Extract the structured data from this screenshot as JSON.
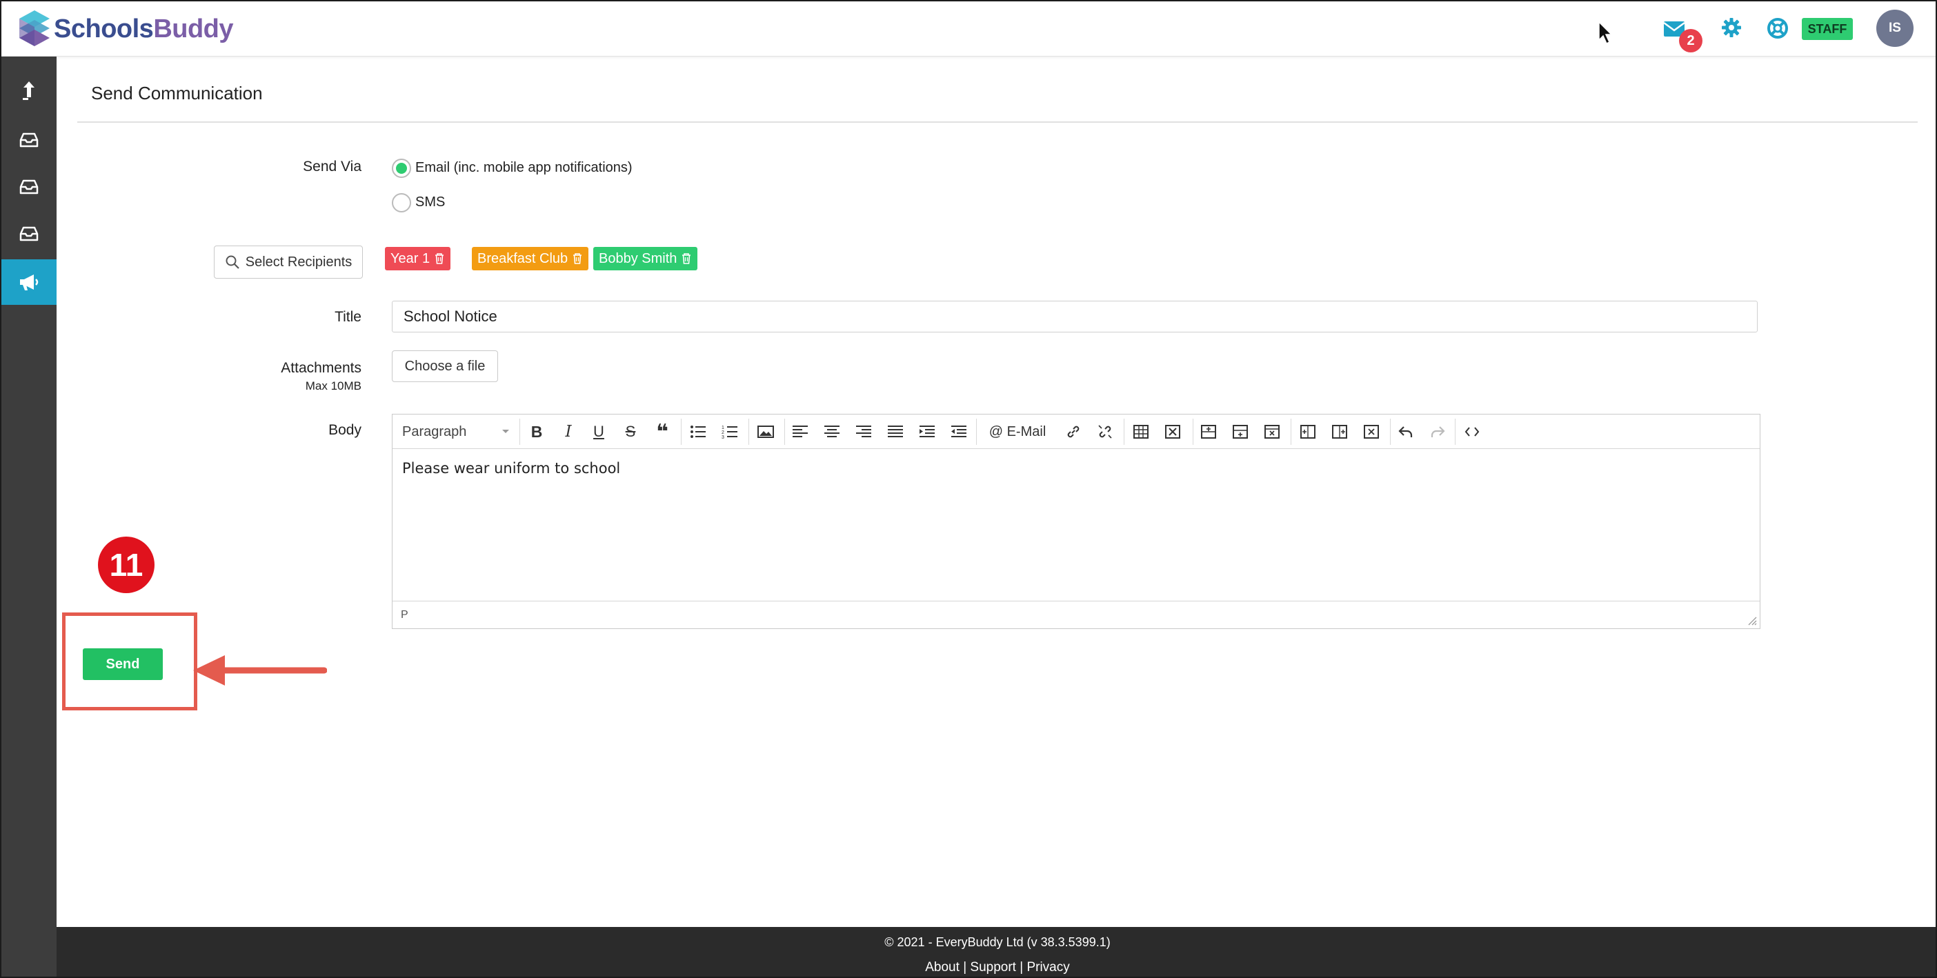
{
  "brand": {
    "name_part1": "Schools",
    "name_part2": "Buddy"
  },
  "header": {
    "mail_count": "2",
    "role_badge": "STAFF",
    "avatar_initials": "IS"
  },
  "sidebar": {
    "items": [
      {
        "icon": "upload-arrow-icon"
      },
      {
        "icon": "inbox-icon"
      },
      {
        "icon": "inbox-icon"
      },
      {
        "icon": "inbox-icon"
      },
      {
        "icon": "megaphone-icon",
        "active": true
      }
    ]
  },
  "page": {
    "title": "Send Communication"
  },
  "form": {
    "send_via_label": "Send Via",
    "send_via_options": [
      {
        "label": "Email (inc. mobile app notifications)",
        "checked": true
      },
      {
        "label": "SMS",
        "checked": false
      }
    ],
    "select_recipients_label": "Select Recipients",
    "recipients": [
      {
        "label": "Year 1",
        "color": "#ef4b55"
      },
      {
        "label": "Breakfast Club",
        "color": "#f39c12"
      },
      {
        "label": "Bobby Smith",
        "color": "#2ecc71"
      }
    ],
    "title_label": "Title",
    "title_value": "School Notice",
    "attachments_label": "Attachments",
    "attachments_sub": "Max 10MB",
    "choose_file_label": "Choose a file",
    "body_label": "Body",
    "editor": {
      "format_select": "Paragraph",
      "email_button": "@ E-Mail",
      "content": "Please wear uniform to school",
      "status_path": "P"
    },
    "send_label": "Send"
  },
  "annotation": {
    "step_number": "11",
    "highlight_color": "#e45b4e"
  },
  "footer": {
    "copyright": "© 2021 - EveryBuddy Ltd (v 38.3.5399.1)",
    "links": [
      "About",
      "Support",
      "Privacy"
    ],
    "separator": "|"
  },
  "colors": {
    "accent": "#1ea2c8",
    "success": "#22c063",
    "sidebar": "#3d3d3d",
    "footer": "#2b2b2b"
  }
}
